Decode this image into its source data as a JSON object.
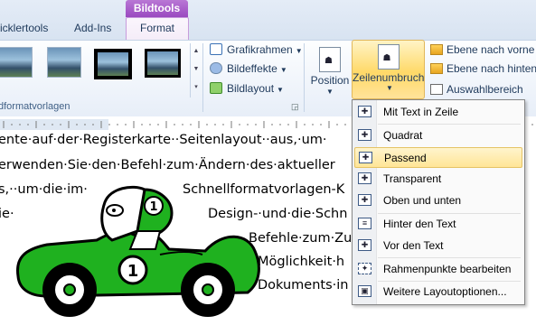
{
  "tabs": {
    "contextual_header": "Bildtools",
    "items": [
      "icklertools",
      "Add-Ins"
    ],
    "active": "Format"
  },
  "ribbon": {
    "styles_group_label": "dformatvorlagen",
    "commands": {
      "rahmen": "Grafikrahmen",
      "effekte": "Bildeffekte",
      "layout": "Bildlayout"
    },
    "position_label": "Position",
    "zeilenumbruch_label": "Zeilenumbruch",
    "arrange": {
      "vorne": "Ebene nach vorne",
      "hinten": "Ebene nach hinten",
      "auswahl": "Auswahlbereich"
    }
  },
  "document_lines": [
    "ente·auf·der·Registerkarte··Seitenlayout··aus,·um·",
    "erwenden·Sie·den·Befehl·zum·Ändern·des·aktueller",
    "s,··um·die·im·",
    "Schnellformatvorlagen-K",
    "ie·",
    "Design-·und·die·Schn",
    "Befehle·zum·Zu",
    "Möglichkeit·h",
    "Dokuments·in"
  ],
  "menu": {
    "items": [
      "Mit Text in Zeile",
      "Quadrat",
      "Passend",
      "Transparent",
      "Oben und unten",
      "Hinter den Text",
      "Vor den Text",
      "Rahmenpunkte bearbeiten",
      "Weitere Layoutoptionen..."
    ],
    "selected_index": 2
  },
  "image": {
    "badge_front": "1",
    "badge_helmet": "1",
    "car_color": "#1fb11f"
  },
  "colors": {
    "contextual_tab": "#9a49c0",
    "highlight": "#ffd968"
  }
}
